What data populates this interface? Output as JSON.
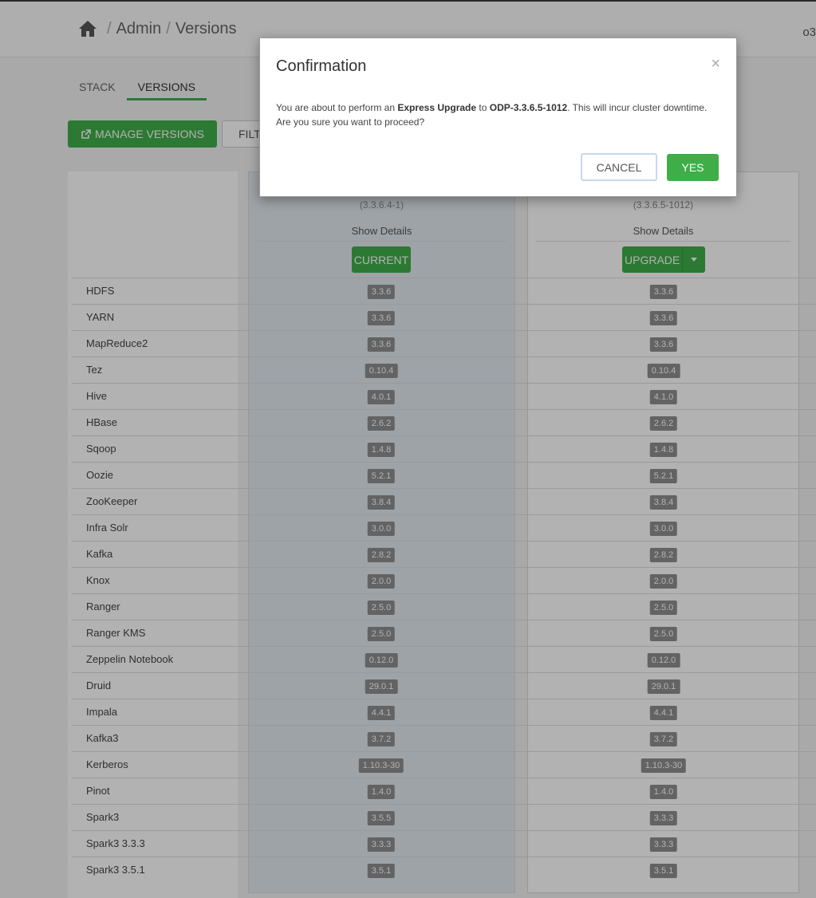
{
  "header": {
    "breadcrumb": [
      "Admin",
      "Versions"
    ],
    "user_truncated": "o3"
  },
  "tabs": [
    {
      "label": "STACK",
      "active": false
    },
    {
      "label": "VERSIONS",
      "active": true
    }
  ],
  "toolbar": {
    "manage_label": "MANAGE VERSIONS",
    "filter_label": "FILTER"
  },
  "columns": {
    "current": {
      "version": "(3.3.6.4-1)",
      "details_label": "Show Details",
      "button_label": "CURRENT"
    },
    "target": {
      "version": "(3.3.6.5-1012)",
      "details_label": "Show Details",
      "button_label": "UPGRADE"
    }
  },
  "services": [
    {
      "name": "HDFS",
      "current": "3.3.6",
      "target": "3.3.6"
    },
    {
      "name": "YARN",
      "current": "3.3.6",
      "target": "3.3.6"
    },
    {
      "name": "MapReduce2",
      "current": "3.3.6",
      "target": "3.3.6"
    },
    {
      "name": "Tez",
      "current": "0.10.4",
      "target": "0.10.4"
    },
    {
      "name": "Hive",
      "current": "4.0.1",
      "target": "4.1.0"
    },
    {
      "name": "HBase",
      "current": "2.6.2",
      "target": "2.6.2"
    },
    {
      "name": "Sqoop",
      "current": "1.4.8",
      "target": "1.4.8"
    },
    {
      "name": "Oozie",
      "current": "5.2.1",
      "target": "5.2.1"
    },
    {
      "name": "ZooKeeper",
      "current": "3.8.4",
      "target": "3.8.4"
    },
    {
      "name": "Infra Solr",
      "current": "3.0.0",
      "target": "3.0.0"
    },
    {
      "name": "Kafka",
      "current": "2.8.2",
      "target": "2.8.2"
    },
    {
      "name": "Knox",
      "current": "2.0.0",
      "target": "2.0.0"
    },
    {
      "name": "Ranger",
      "current": "2.5.0",
      "target": "2.5.0"
    },
    {
      "name": "Ranger KMS",
      "current": "2.5.0",
      "target": "2.5.0"
    },
    {
      "name": "Zeppelin Notebook",
      "current": "0.12.0",
      "target": "0.12.0"
    },
    {
      "name": "Druid",
      "current": "29.0.1",
      "target": "29.0.1"
    },
    {
      "name": "Impala",
      "current": "4.4.1",
      "target": "4.4.1"
    },
    {
      "name": "Kafka3",
      "current": "3.7.2",
      "target": "3.7.2"
    },
    {
      "name": "Kerberos",
      "current": "1.10.3-30",
      "target": "1.10.3-30"
    },
    {
      "name": "Pinot",
      "current": "1.4.0",
      "target": "1.4.0"
    },
    {
      "name": "Spark3",
      "current": "3.5.5",
      "target": "3.3.3"
    },
    {
      "name": "Spark3 3.3.3",
      "current": "3.3.3",
      "target": "3.3.3"
    },
    {
      "name": "Spark3 3.5.1",
      "current": "3.5.1",
      "target": "3.5.1"
    }
  ],
  "modal": {
    "title": "Confirmation",
    "close_symbol": "×",
    "text_1": "You are about to perform an ",
    "upgrade_type": "Express Upgrade",
    "text_2": " to ",
    "target_version": "ODP-3.3.6.5-1012",
    "text_3": ". This will incur cluster downtime.",
    "question": "Are you sure you want to proceed?",
    "cancel_label": "CANCEL",
    "yes_label": "YES"
  },
  "colors": {
    "accent_green": "#3fae49",
    "badge_gray": "#8f8f8f"
  }
}
